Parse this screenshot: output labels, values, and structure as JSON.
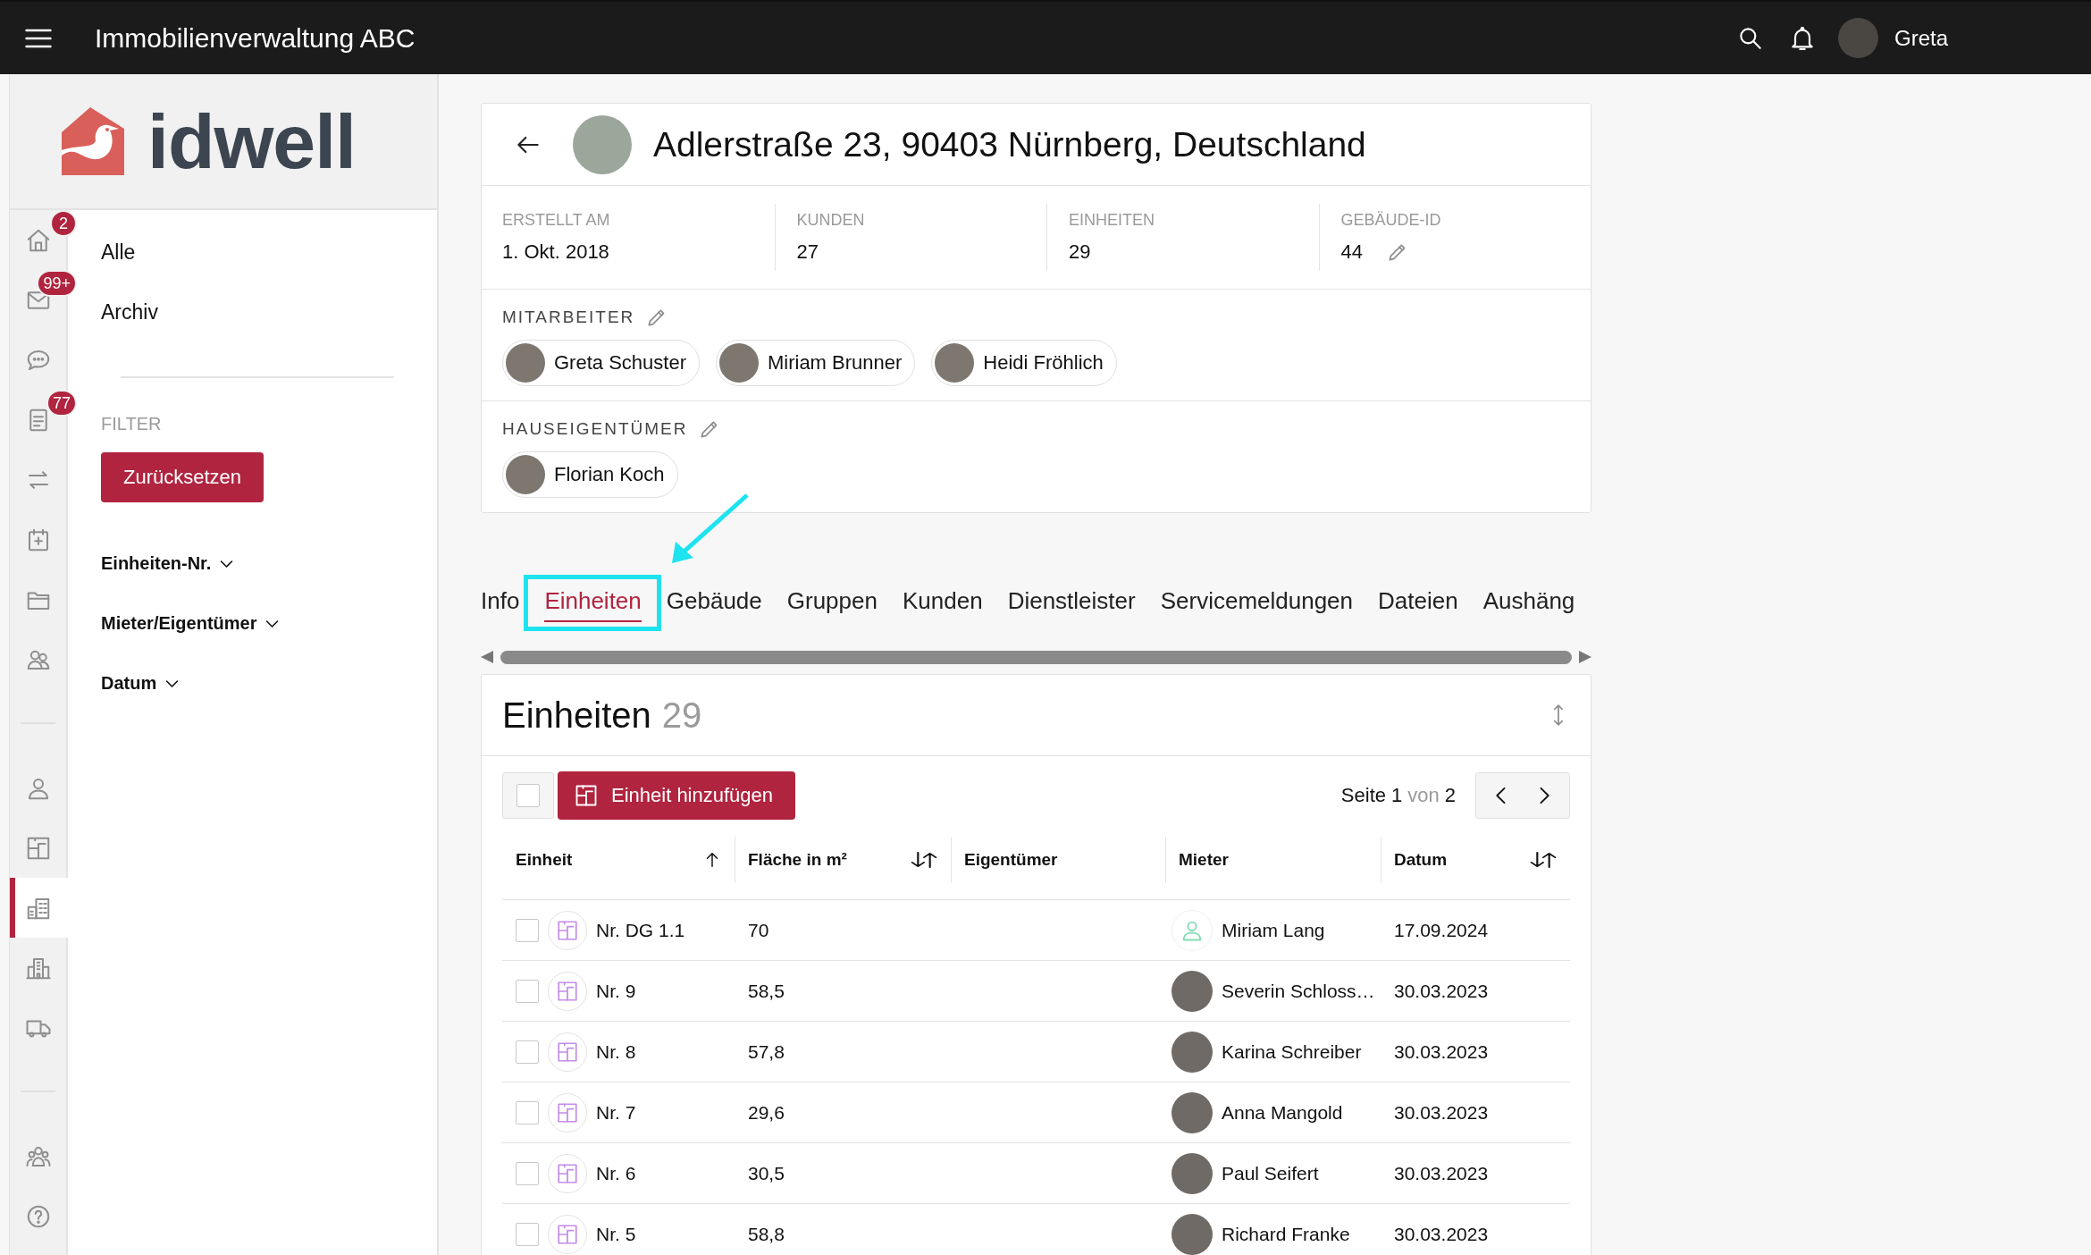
{
  "top_bar": {
    "title": "Immobilienverwaltung ABC",
    "user": {
      "name": "Greta"
    }
  },
  "logo": {
    "text": "idwell"
  },
  "rail": {
    "sections": [
      {
        "items": [
          {
            "badge": "2",
            "selected": false
          },
          {
            "badge": "99+",
            "selected": false
          },
          {
            "selected": false
          },
          {
            "badge": "77",
            "selected": false
          },
          {
            "selected": false
          },
          {
            "selected": false
          },
          {
            "selected": false
          },
          {
            "selected": false
          }
        ]
      },
      {
        "items": [
          {
            "selected": false
          },
          {
            "selected": false
          },
          {
            "selected": true
          },
          {
            "selected": false
          },
          {
            "selected": false
          }
        ]
      },
      {
        "items": [
          {
            "selected": false
          },
          {
            "selected": false
          }
        ]
      }
    ]
  },
  "filter_panel": {
    "views": [
      {
        "label": "Alle"
      },
      {
        "label": "Archiv"
      }
    ],
    "filter_heading": "FILTER",
    "reset_button": "Zurücksetzen",
    "filters": [
      {
        "label": "Einheiten-Nr."
      },
      {
        "label": "Mieter/Eigentümer"
      },
      {
        "label": "Datum"
      }
    ]
  },
  "building": {
    "title": "Adlerstraße 23, 90403 Nürnberg, Deutschland",
    "stats": [
      {
        "label": "ERSTELLT AM",
        "value": "1. Okt. 2018",
        "editable": false
      },
      {
        "label": "KUNDEN",
        "value": "27",
        "editable": false
      },
      {
        "label": "EINHEITEN",
        "value": "29",
        "editable": false
      },
      {
        "label": "GEBÄUDE-ID",
        "value": "44",
        "editable": true
      }
    ],
    "people_sections": [
      {
        "heading": "MITARBEITER",
        "people": [
          {
            "name": "Greta Schuster"
          },
          {
            "name": "Miriam Brunner"
          },
          {
            "name": "Heidi Fröhlich"
          }
        ]
      },
      {
        "heading": "HAUSEIGENTÜMER",
        "people": [
          {
            "name": "Florian Koch"
          }
        ]
      }
    ]
  },
  "tabs": [
    {
      "label": "Info",
      "selected": false
    },
    {
      "label": "Einheiten",
      "selected": true
    },
    {
      "label": "Gebäude",
      "selected": false
    },
    {
      "label": "Gruppen",
      "selected": false
    },
    {
      "label": "Kunden",
      "selected": false
    },
    {
      "label": "Dienstleister",
      "selected": false
    },
    {
      "label": "Servicemeldungen",
      "selected": false
    },
    {
      "label": "Dateien",
      "selected": false
    },
    {
      "label": "Aushäng",
      "selected": false
    }
  ],
  "units": {
    "title": "Einheiten",
    "count": "29",
    "select_all_checked": false,
    "add_button": "Einheit hinzufügen",
    "pagination": {
      "page_label": "Seite",
      "page": "1",
      "of_label": "von",
      "pages": "2"
    },
    "columns": [
      {
        "label": "Einheit",
        "sortable": true,
        "sorted": true
      },
      {
        "label": "Fläche in m²",
        "sortable": true,
        "sorted": false
      },
      {
        "label": "Eigentümer",
        "sortable": false
      },
      {
        "label": "Mieter",
        "sortable": false
      },
      {
        "label": "Datum",
        "sortable": true,
        "sorted": false
      }
    ],
    "rows": [
      {
        "checked": false,
        "unit": "Nr. DG 1.1",
        "area": "70",
        "tenant": {
          "name": "Miriam Lang",
          "kind": "placeholder"
        },
        "date": "17.09.2024"
      },
      {
        "checked": false,
        "unit": "Nr. 9",
        "area": "58,5",
        "tenant": {
          "name": "Severin Schloss…",
          "kind": "photo"
        },
        "date": "30.03.2023"
      },
      {
        "checked": false,
        "unit": "Nr. 8",
        "area": "57,8",
        "tenant": {
          "name": "Karina Schreiber",
          "kind": "photo"
        },
        "date": "30.03.2023"
      },
      {
        "checked": false,
        "unit": "Nr. 7",
        "area": "29,6",
        "tenant": {
          "name": "Anna Mangold",
          "kind": "photo"
        },
        "date": "30.03.2023"
      },
      {
        "checked": false,
        "unit": "Nr. 6",
        "area": "30,5",
        "tenant": {
          "name": "Paul Seifert",
          "kind": "photo"
        },
        "date": "30.03.2023"
      },
      {
        "checked": false,
        "unit": "Nr. 5",
        "area": "58,8",
        "tenant": {
          "name": "Richard Franke",
          "kind": "photo"
        },
        "date": "30.03.2023"
      }
    ]
  }
}
